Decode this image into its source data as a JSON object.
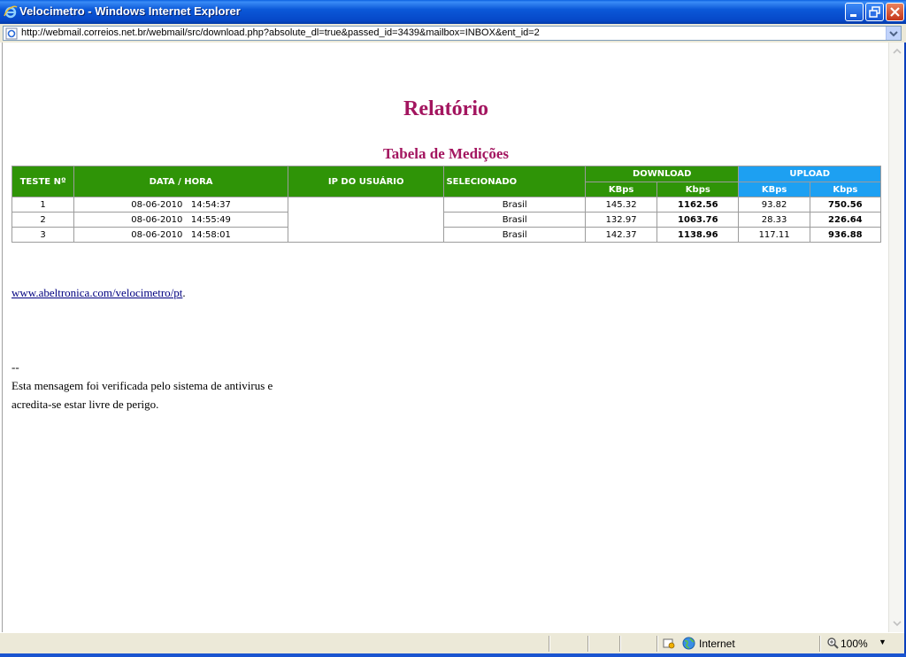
{
  "window": {
    "title": "Velocimetro - Windows Internet Explorer",
    "url": "http://webmail.correios.net.br/webmail/src/download.php?absolute_dl=true&passed_id=3439&mailbox=INBOX&ent_id=2"
  },
  "report": {
    "title": "Relatório",
    "table_title": "Tabela de Medições",
    "headers": {
      "teste": "TESTE Nº",
      "data_hora": "DATA / HORA",
      "ip": "IP DO USUÁRIO",
      "selecionado": "SELECIONADO",
      "download": "DOWNLOAD",
      "upload": "UPLOAD",
      "kbps_bytes": "KBps",
      "kbps_bits": "Kbps"
    },
    "rows": [
      {
        "n": "1",
        "datetime": "08-06-2010   14:54:37",
        "sel": "Brasil",
        "dl_KBps": "145.32",
        "dl_Kbps": "1162.56",
        "ul_KBps": "93.82",
        "ul_Kbps": "750.56"
      },
      {
        "n": "2",
        "datetime": "08-06-2010   14:55:49",
        "sel": "Brasil",
        "dl_KBps": "132.97",
        "dl_Kbps": "1063.76",
        "ul_KBps": "28.33",
        "ul_Kbps": "226.64"
      },
      {
        "n": "3",
        "datetime": "08-06-2010   14:58:01",
        "sel": "Brasil",
        "dl_KBps": "142.37",
        "dl_Kbps": "1138.96",
        "ul_KBps": "117.11",
        "ul_Kbps": "936.88"
      }
    ]
  },
  "link": {
    "text": "www.abeltronica.com/velocimetro/pt",
    "trailing": "."
  },
  "signature": {
    "dashes": "--",
    "line1": "Esta mensagem foi verificada pelo sistema de antivirus e",
    "line2": "acredita-se estar livre de perigo."
  },
  "statusbar": {
    "zone": "Internet",
    "zoom": "100%"
  },
  "colors": {
    "accent": "#a3155f",
    "header_green": "#2f9407",
    "header_blue": "#1da0f2"
  }
}
